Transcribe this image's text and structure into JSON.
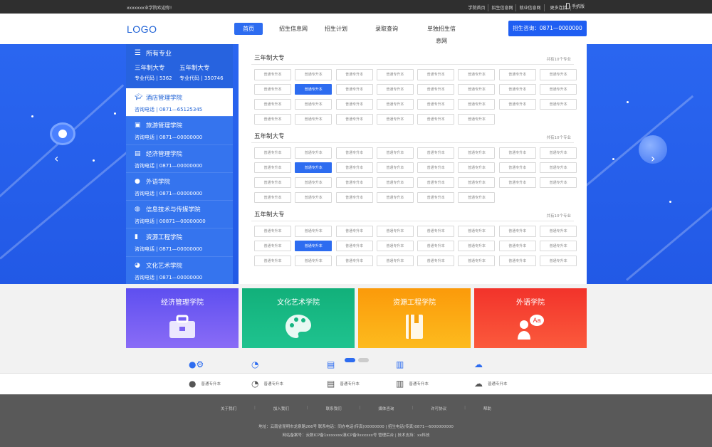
{
  "topbar": {
    "welcome": "xxxxxxx业学院欢迎你!",
    "links": [
      "学院首页",
      "招生信息网",
      "就业信息网",
      "更多连接"
    ],
    "more_icon": "chevron-down-icon",
    "mobile": "手机版"
  },
  "header": {
    "logo": "LOGO",
    "nav": [
      "首页",
      "招生信息网",
      "招生计划",
      "录取查询",
      "单独招生信息网"
    ],
    "hotline": "招生咨询：0871—0000000"
  },
  "colors": {
    "primary": "#2d6cf0",
    "hero_bg": "#2a66f0",
    "card_purple": "#6a59ef",
    "card_green": "#14b981",
    "card_orange": "#fba50b",
    "card_red": "#f53a2e",
    "footer_bg": "#595959"
  },
  "sidebar": {
    "all_majors": "所有专业",
    "three_year": "三年制大专",
    "five_year": "五年制大专",
    "code3_label": "专业代码",
    "code3": "5362",
    "code5_label": "专业代码",
    "code5": "350746",
    "items": [
      {
        "name": "酒店管理学院",
        "phone": "咨询电话 | 0871—65125345",
        "icon": "graduation-cap-icon"
      },
      {
        "name": "旅游管理学院",
        "phone": "咨询电话 | 0871—00000000",
        "icon": "suitcase-icon"
      },
      {
        "name": "经济管理学院",
        "phone": "咨询电话 | 0871—00000000",
        "icon": "briefcase-icon"
      },
      {
        "name": "外语学院",
        "phone": "咨询电话 | 0871—00000000",
        "icon": "chat-icon"
      },
      {
        "name": "信息技术与传媒学院",
        "phone": "咨询电话 | 00871—00000000",
        "icon": "globe-icon"
      },
      {
        "name": "资源工程学院",
        "phone": "咨询电话 | 0871—00000000",
        "icon": "book-icon"
      },
      {
        "name": "文化艺术学院",
        "phone": "咨询电话 | 0871—00000000",
        "icon": "palette-icon"
      }
    ]
  },
  "sections": [
    {
      "title": "三年制大专",
      "count": "共有10个专业",
      "tag": "普通专升本",
      "rows": 4,
      "last_row": 6,
      "active_index": 9
    },
    {
      "title": "五年制大专",
      "count": "共有10个专业",
      "tag": "普通专升本",
      "rows": 4,
      "last_row": 6,
      "active_index": 9
    },
    {
      "title": "五年制大专",
      "count": "共有10个专业",
      "tag": "普通专升本",
      "rows": 3,
      "last_row": 8,
      "active_index": 9
    }
  ],
  "cards": [
    {
      "title": "经济管理学院",
      "icon": "toolbox-icon"
    },
    {
      "title": "文化艺术学院",
      "icon": "palette-icon"
    },
    {
      "title": "资源工程学院",
      "icon": "book-icon"
    },
    {
      "title": "外语学院",
      "icon": "speaker-icon"
    }
  ],
  "links_row": [
    {
      "label": "普通专升本",
      "icon": "user-gear-icon"
    },
    {
      "label": "普通专升本",
      "icon": "pie-chart-icon"
    },
    {
      "label": "普通专升本",
      "icon": "id-card-icon"
    },
    {
      "label": "普通专升本",
      "icon": "bar-chart-icon"
    },
    {
      "label": "普通专升本",
      "icon": "cloud-icon"
    }
  ],
  "footer": {
    "links": [
      "关于我们",
      "加入我们",
      "联系我们",
      "媒体咨询",
      "许可协议",
      "帮助"
    ],
    "address": "地址：云南省昆明市龙泉路266号   联系电话：同办电话(传真)00000000 | 招生电话(传真)0871—6000000000",
    "record": "网站备案号：云数ICP备1xxxxxxx滇ICP备0xxxxxx号   管理后台 | 技术支持：xx科技"
  }
}
